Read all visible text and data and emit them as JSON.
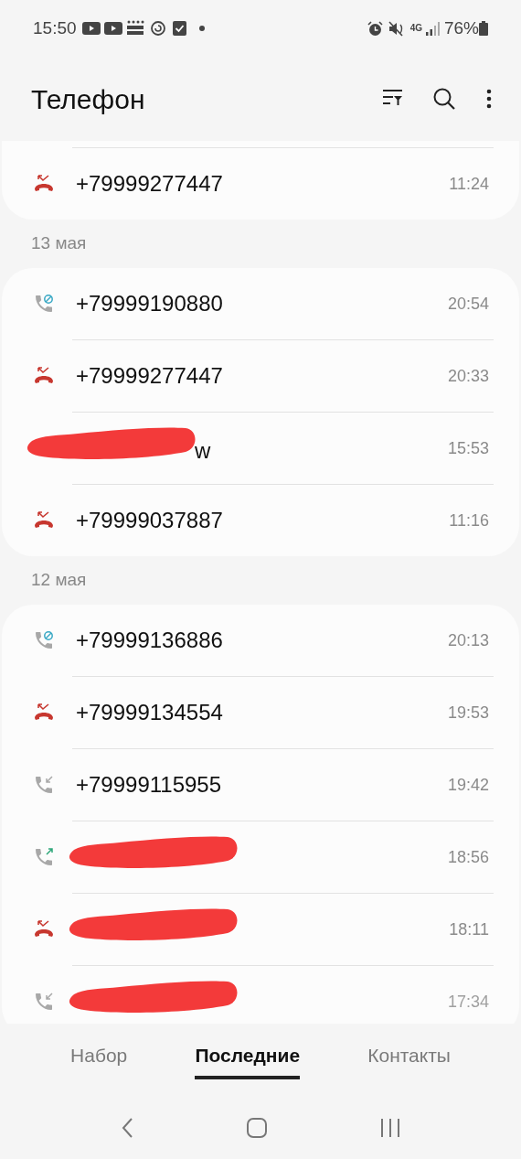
{
  "status_bar": {
    "time": "15:50",
    "network": "4G",
    "battery": "76%"
  },
  "header": {
    "title": "Телефон"
  },
  "groups": [
    {
      "cut_top": true,
      "calls": [
        {
          "kind": "missed",
          "number": "+79999277447",
          "time": "11:24",
          "redacted": false
        }
      ]
    },
    {
      "date": "13 мая",
      "calls": [
        {
          "kind": "blocked",
          "number": "+79999190880",
          "time": "20:54",
          "redacted": false
        },
        {
          "kind": "missed",
          "number": "+79999277447",
          "time": "20:33",
          "redacted": false
        },
        {
          "kind": "none",
          "number": "w",
          "time": "15:53",
          "redacted": true
        },
        {
          "kind": "missed",
          "number": "+79999037887",
          "time": "11:16",
          "redacted": false
        }
      ]
    },
    {
      "date": "12 мая",
      "calls": [
        {
          "kind": "blocked",
          "number": "+79999136886",
          "time": "20:13",
          "redacted": false
        },
        {
          "kind": "missed",
          "number": "+79999134554",
          "time": "19:53",
          "redacted": false
        },
        {
          "kind": "incoming",
          "number": "+79999115955",
          "time": "19:42",
          "redacted": false
        },
        {
          "kind": "outgoing",
          "time": "18:56",
          "redacted": true
        },
        {
          "kind": "missed",
          "time": "18:11",
          "redacted": true
        },
        {
          "kind": "incoming",
          "time": "17:34",
          "redacted": true
        }
      ]
    }
  ],
  "tabs": [
    {
      "label": "Набор",
      "selected": false
    },
    {
      "label": "Последние",
      "selected": true
    },
    {
      "label": "Контакты",
      "selected": false
    }
  ]
}
